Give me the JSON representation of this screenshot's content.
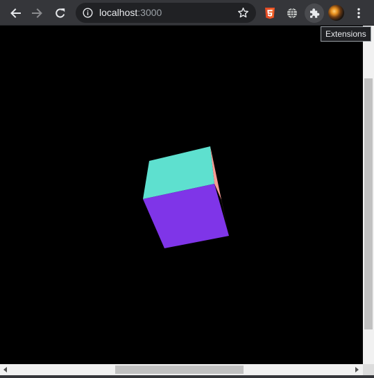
{
  "browser": {
    "url_host": "localhost",
    "url_port": ":3000",
    "tooltip": "Extensions"
  },
  "toolbar_icons": {
    "back": "arrow-left-icon",
    "forward": "arrow-right-icon",
    "reload": "reload-icon",
    "site_info": "info-icon",
    "bookmark": "star-icon",
    "html5_extension": "html5-icon",
    "globe_extension": "globe-icon",
    "extensions": "puzzle-icon",
    "profile": "avatar",
    "menu": "kebab-menu-icon"
  },
  "cube": {
    "top_face_color": "#5ee0cf",
    "front_face_color": "#7f35e8",
    "side_face_color": "#f79b94"
  },
  "colors": {
    "toolbar_bg": "#35363a",
    "omnibox_bg": "#202124",
    "page_bg": "#000000",
    "scrollbar_track": "#f1f1f1",
    "scrollbar_thumb": "#c1c1c1"
  }
}
